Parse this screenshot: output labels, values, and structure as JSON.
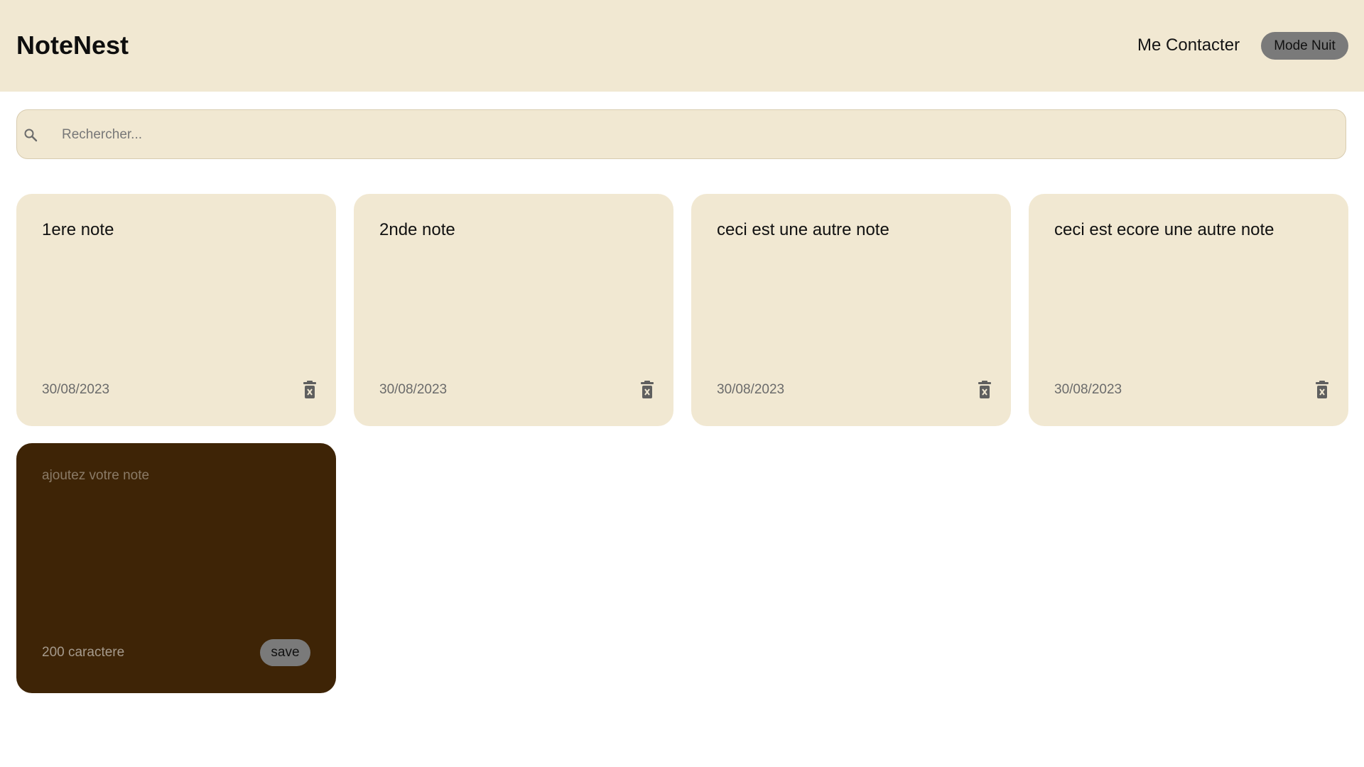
{
  "header": {
    "brand": "NoteNest",
    "contact_label": "Me Contacter",
    "night_mode_label": "Mode Nuit"
  },
  "search": {
    "icon": "search-icon",
    "placeholder": "Rechercher...",
    "value": ""
  },
  "notes": [
    {
      "text": "1ere note",
      "date": "30/08/2023",
      "delete_icon": "trash-icon"
    },
    {
      "text": "2nde note",
      "date": "30/08/2023",
      "delete_icon": "trash-icon"
    },
    {
      "text": "ceci est une autre note",
      "date": "30/08/2023",
      "delete_icon": "trash-icon"
    },
    {
      "text": "ceci est ecore une autre note",
      "date": "30/08/2023",
      "delete_icon": "trash-icon"
    }
  ],
  "new_note": {
    "placeholder": "ajoutez votre note",
    "value": "",
    "char_count": "200 caractere",
    "save_label": "save"
  },
  "colors": {
    "background": "#ffffff",
    "header": "#f1e8d2",
    "card": "#f1e8d2",
    "new_card": "#3e2406",
    "button": "#7a7a7a"
  }
}
